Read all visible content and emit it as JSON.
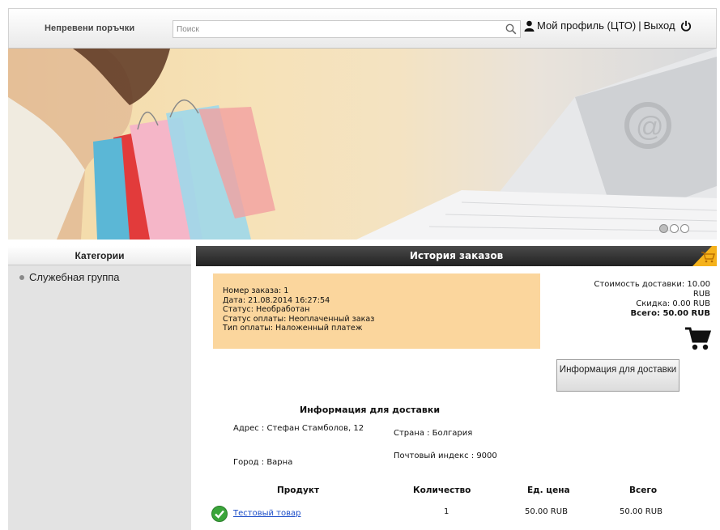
{
  "header": {
    "brand": "Непревени поръчки",
    "search_placeholder": "Поиск",
    "profile_link": "Мой профиль (ЦТО)",
    "separator": "|",
    "logout_link": "Выход",
    "icons": [
      "search-icon",
      "user-icon",
      "power-icon"
    ]
  },
  "banner": {
    "slides": [
      {
        "active": true
      },
      {
        "active": false
      },
      {
        "active": false
      }
    ]
  },
  "sidebar": {
    "title": "Категории",
    "items": [
      {
        "label": "Служебная группа"
      }
    ]
  },
  "main": {
    "title": "История заказов",
    "order": {
      "number": "Номер заказа: 1",
      "date": "Дата: 21.08.2014 16:27:54",
      "status": "Статус: Необработан",
      "payment_status": "Статус оплаты: Неоплаченный заказ",
      "payment_type": "Тип оплаты: Наложенный платеж"
    },
    "totals": {
      "shipping_label": "Стоимость доставки: 10.00",
      "shipping_currency": "RUB",
      "discount": "Скидка: 0.00 RUB",
      "total": "Всего: 50.00 RUB"
    },
    "delivery_button": "Информация для доставки",
    "shipping": {
      "title": "Информация для доставки",
      "address": "Адрес : Стефан Стамболов, 12",
      "country": "Страна : Болгария",
      "city": "Город : Варна",
      "postal": "Почтовый индекс : 9000"
    },
    "table": {
      "headers": [
        "Продукт",
        "Количество",
        "Ед. цена",
        "Всего"
      ],
      "rows": [
        {
          "product": "Тестовый товар",
          "quantity": "1",
          "unit_price": "50.00 RUB",
          "total": "50.00 RUB"
        }
      ]
    }
  },
  "colors": {
    "order_box": "#fbd69d",
    "header_dark": "#2a2a2a",
    "link": "#1a4cc8",
    "sidebar_bg": "#e3e3e3"
  }
}
